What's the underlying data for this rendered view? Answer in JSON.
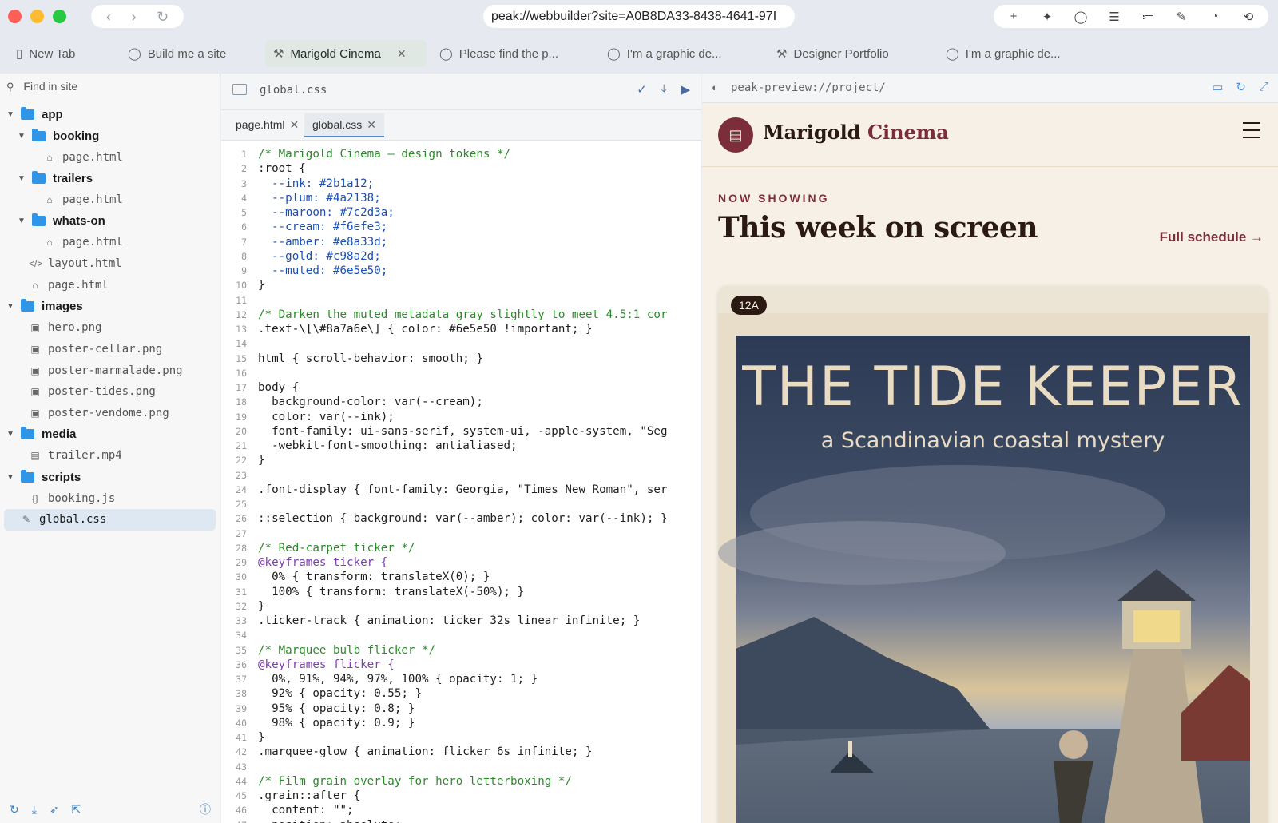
{
  "browser": {
    "url": "peak://webbuilder?site=A0B8DA33-8438-4641-97I",
    "tabs": [
      {
        "label": "New Tab",
        "icon": "page-icon"
      },
      {
        "label": "Build me a site",
        "icon": "chat-icon"
      },
      {
        "label": "Marigold Cinema",
        "icon": "hammer-icon"
      },
      {
        "label": "Please find the p...",
        "icon": "chat-icon"
      },
      {
        "label": "I'm a graphic de...",
        "icon": "chat-icon"
      },
      {
        "label": "Designer Portfolio",
        "icon": "hammer-icon"
      },
      {
        "label": "I'm a graphic de...",
        "icon": "chat-icon"
      }
    ]
  },
  "sidebar": {
    "search_placeholder": "Find in site",
    "tree": [
      {
        "label": "app",
        "type": "folder"
      },
      {
        "label": "booking",
        "type": "folder"
      },
      {
        "label": "page.html",
        "type": "file"
      },
      {
        "label": "trailers",
        "type": "folder"
      },
      {
        "label": "page.html",
        "type": "file"
      },
      {
        "label": "whats-on",
        "type": "folder"
      },
      {
        "label": "page.html",
        "type": "file"
      },
      {
        "label": "layout.html",
        "type": "file"
      },
      {
        "label": "page.html",
        "type": "file"
      },
      {
        "label": "images",
        "type": "folder"
      },
      {
        "label": "hero.png",
        "type": "file"
      },
      {
        "label": "poster-cellar.png",
        "type": "file"
      },
      {
        "label": "poster-marmalade.png",
        "type": "file"
      },
      {
        "label": "poster-tides.png",
        "type": "file"
      },
      {
        "label": "poster-vendome.png",
        "type": "file"
      },
      {
        "label": "media",
        "type": "folder"
      },
      {
        "label": "trailer.mp4",
        "type": "file"
      },
      {
        "label": "scripts",
        "type": "folder"
      },
      {
        "label": "booking.js",
        "type": "file"
      },
      {
        "label": "global.css",
        "type": "file",
        "selected": true
      }
    ]
  },
  "editor": {
    "filename": "global.css",
    "tabs": [
      {
        "label": "page.html"
      },
      {
        "label": "global.css",
        "active": true
      }
    ],
    "lines": [
      "/* Marigold Cinema — design tokens */",
      ":root {",
      "  --ink: #2b1a12;",
      "  --plum: #4a2138;",
      "  --maroon: #7c2d3a;",
      "  --cream: #f6efe3;",
      "  --amber: #e8a33d;",
      "  --gold: #c98a2d;",
      "  --muted: #6e5e50;",
      "}",
      "",
      "/* Darken the muted metadata gray slightly to meet 4.5:1 cor",
      ".text-\\[\\#8a7a6e\\] { color: #6e5e50 !important; }",
      "",
      "html { scroll-behavior: smooth; }",
      "",
      "body {",
      "  background-color: var(--cream);",
      "  color: var(--ink);",
      "  font-family: ui-sans-serif, system-ui, -apple-system, \"Seg",
      "  -webkit-font-smoothing: antialiased;",
      "}",
      "",
      ".font-display { font-family: Georgia, \"Times New Roman\", ser",
      "",
      "::selection { background: var(--amber); color: var(--ink); }",
      "",
      "/* Red-carpet ticker */",
      "@keyframes ticker {",
      "  0% { transform: translateX(0); }",
      "  100% { transform: translateX(-50%); }",
      "}",
      ".ticker-track { animation: ticker 32s linear infinite; }",
      "",
      "/* Marquee bulb flicker */",
      "@keyframes flicker {",
      "  0%, 91%, 94%, 97%, 100% { opacity: 1; }",
      "  92% { opacity: 0.55; }",
      "  95% { opacity: 0.8; }",
      "  98% { opacity: 0.9; }",
      "}",
      ".marquee-glow { animation: flicker 6s infinite; }",
      "",
      "/* Film grain overlay for hero letterboxing */",
      ".grain::after {",
      "  content: \"\";",
      "  position: absolute;"
    ]
  },
  "preview": {
    "url": "peak-preview://project/",
    "brand_main": "Marigold",
    "brand_accent": "Cinema",
    "eyebrow": "NOW SHOWING",
    "headline": "This week on screen",
    "schedule_link": "Full schedule →",
    "rating": "12A",
    "poster_title": "THE TIDE KEEPER",
    "poster_subtitle": "a Scandinavian coastal mystery"
  },
  "colors": {
    "ink": "#2b1a12",
    "maroon": "#7c2d3a",
    "cream": "#f6efe3",
    "accent_blue": "#2f95e8"
  }
}
